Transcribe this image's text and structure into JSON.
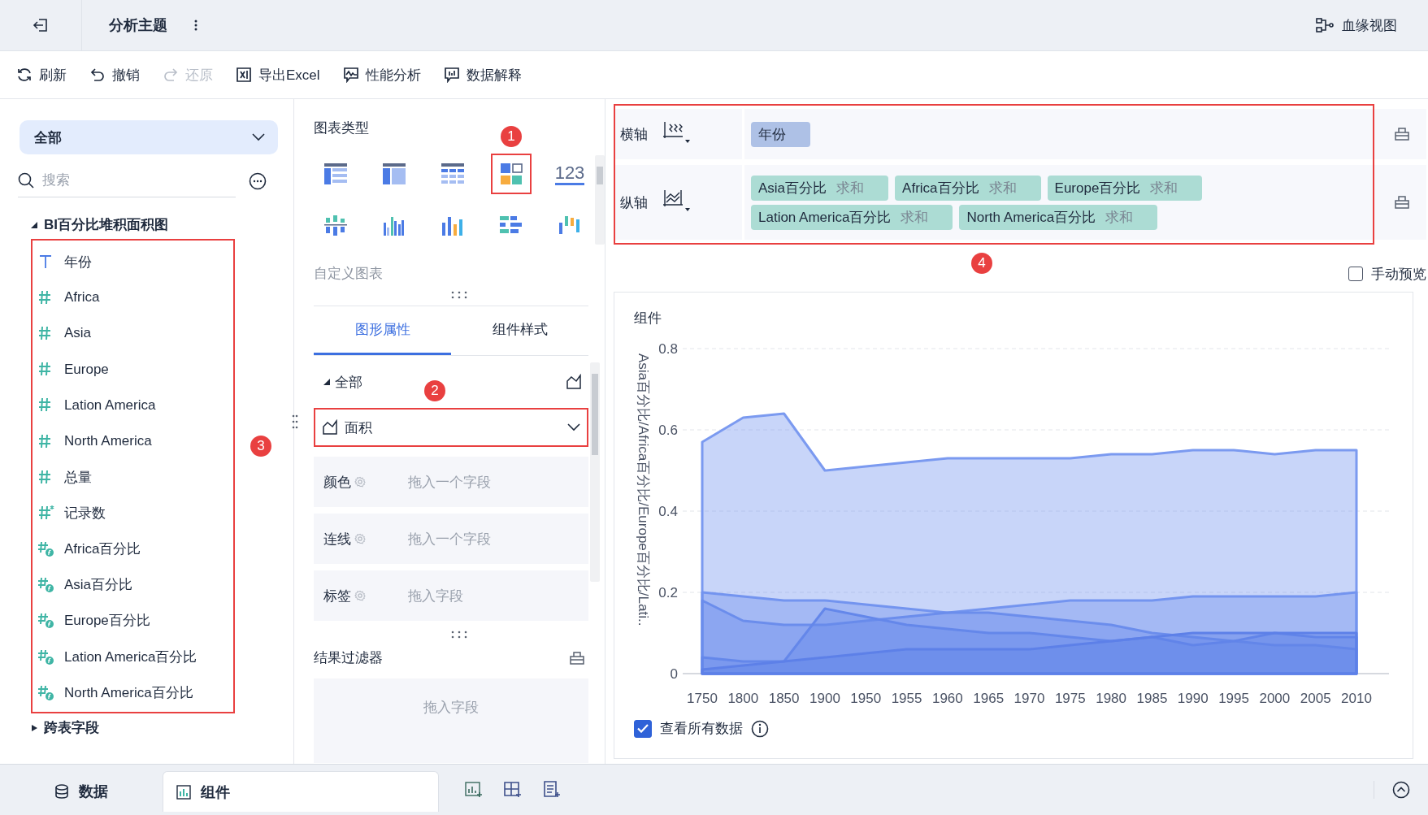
{
  "header": {
    "title": "分析主题",
    "lineage": "血缘视图"
  },
  "toolbar": [
    {
      "kind": "refresh",
      "label": "刷新",
      "disabled": false
    },
    {
      "kind": "undo",
      "label": "撤销",
      "disabled": false
    },
    {
      "kind": "redo",
      "label": "还原",
      "disabled": true
    },
    {
      "kind": "excel",
      "label": "导出Excel",
      "disabled": false
    },
    {
      "kind": "performance",
      "label": "性能分析",
      "disabled": false
    },
    {
      "kind": "explain",
      "label": "数据解释",
      "disabled": false
    }
  ],
  "data_panel": {
    "scope": "全部",
    "search": {
      "placeholder": "搜索"
    },
    "dataset": {
      "label": "BI百分比堆积面积图",
      "expanded": true,
      "callout": "3",
      "fields": [
        {
          "label": "年份",
          "kind": "text"
        },
        {
          "label": "Africa",
          "kind": "number"
        },
        {
          "label": "Asia",
          "kind": "number"
        },
        {
          "label": "Europe",
          "kind": "number"
        },
        {
          "label": "Lation America",
          "kind": "number"
        },
        {
          "label": "North America",
          "kind": "number"
        },
        {
          "label": "总量",
          "kind": "number"
        },
        {
          "label": "记录数",
          "kind": "count"
        },
        {
          "label": "Africa百分比",
          "kind": "calc"
        },
        {
          "label": "Asia百分比",
          "kind": "calc"
        },
        {
          "label": "Europe百分比",
          "kind": "calc"
        },
        {
          "label": "Lation America百分比",
          "kind": "calc"
        },
        {
          "label": "North America百分比",
          "kind": "calc"
        }
      ]
    },
    "other_group": {
      "label": "跨表字段",
      "expanded": false
    }
  },
  "chart_types": {
    "title": "图表类型",
    "items": [
      {
        "kind": "table",
        "selected": false
      },
      {
        "kind": "cross_table",
        "selected": false
      },
      {
        "kind": "detail_table",
        "selected": false
      },
      {
        "kind": "dashboard",
        "selected": true,
        "callout": "1"
      },
      {
        "kind": "kpi",
        "label": "123",
        "selected": false
      },
      {
        "kind": "dot_column",
        "selected": false
      },
      {
        "kind": "grouped_column",
        "selected": false
      },
      {
        "kind": "column",
        "selected": false
      },
      {
        "kind": "bar",
        "selected": false
      },
      {
        "kind": "range_column",
        "selected": false
      }
    ],
    "custom_label": "自定义图表"
  },
  "property_tabs": [
    {
      "label": "图形属性",
      "selected": true
    },
    {
      "label": "组件样式",
      "selected": false
    }
  ],
  "marks": {
    "scope": "全部",
    "expanded": true,
    "mark_type": "面积",
    "callout": "2",
    "slots": [
      {
        "label": "颜色",
        "placeholder": "拖入一个字段"
      },
      {
        "label": "连线",
        "placeholder": "拖入一个字段"
      },
      {
        "label": "标签",
        "placeholder": "拖入字段"
      }
    ]
  },
  "result_filter": {
    "title": "结果过滤器",
    "placeholder": "拖入字段"
  },
  "axes_callout": "4",
  "axes": [
    {
      "label": "横轴",
      "kind": "x",
      "fields": [
        {
          "name": "年份",
          "kind": "dimension"
        }
      ]
    },
    {
      "label": "纵轴",
      "kind": "y",
      "fields": [
        {
          "name": "Asia百分比",
          "aggregation": "求和",
          "kind": "measure"
        },
        {
          "name": "Africa百分比",
          "aggregation": "求和",
          "kind": "measure"
        },
        {
          "name": "Europe百分比",
          "aggregation": "求和",
          "kind": "measure"
        },
        {
          "name": "Lation America百分比",
          "aggregation": "求和",
          "kind": "measure"
        },
        {
          "name": "North America百分比",
          "aggregation": "求和",
          "kind": "measure"
        }
      ]
    }
  ],
  "manual_preview": {
    "label": "手动预览",
    "checked": false
  },
  "component": {
    "title": "组件",
    "chart_data": {
      "type": "area",
      "ylabel": "Asia百分比/Africa百分比/Europe百分比/Lati..",
      "categories": [
        "1750",
        "1800",
        "1850",
        "1900",
        "1950",
        "1955",
        "1960",
        "1965",
        "1970",
        "1975",
        "1980",
        "1985",
        "1990",
        "1995",
        "2000",
        "2005",
        "2010"
      ],
      "stacked": false,
      "grid": true,
      "ylim": [
        0,
        0.8
      ],
      "yticks": [
        0,
        0.2,
        0.4,
        0.6,
        0.8
      ],
      "series": [
        {
          "color": "#7b9af0",
          "values": [
            0.57,
            0.63,
            0.64,
            0.5,
            0.51,
            0.52,
            0.53,
            0.53,
            0.53,
            0.53,
            0.54,
            0.54,
            0.55,
            0.55,
            0.54,
            0.55,
            0.55
          ]
        },
        {
          "color": "#7394ef",
          "values": [
            0.2,
            0.19,
            0.18,
            0.18,
            0.17,
            0.16,
            0.15,
            0.16,
            0.17,
            0.18,
            0.18,
            0.18,
            0.19,
            0.19,
            0.19,
            0.19,
            0.2
          ]
        },
        {
          "color": "#6b8dec",
          "values": [
            0.18,
            0.13,
            0.12,
            0.12,
            0.13,
            0.14,
            0.15,
            0.15,
            0.14,
            0.13,
            0.12,
            0.1,
            0.09,
            0.08,
            0.07,
            0.07,
            0.06
          ]
        },
        {
          "color": "#6487ea",
          "values": [
            0.04,
            0.03,
            0.03,
            0.16,
            0.14,
            0.12,
            0.11,
            0.1,
            0.1,
            0.09,
            0.08,
            0.09,
            0.07,
            0.08,
            0.1,
            0.09,
            0.09
          ]
        },
        {
          "color": "#5d80e8",
          "values": [
            0.01,
            0.02,
            0.03,
            0.04,
            0.05,
            0.06,
            0.06,
            0.06,
            0.06,
            0.07,
            0.08,
            0.09,
            0.1,
            0.1,
            0.1,
            0.1,
            0.1
          ]
        }
      ]
    },
    "show_all_data": {
      "label": "查看所有数据",
      "checked": true
    }
  },
  "bottom_tabs": [
    {
      "label": "数据",
      "kind": "data",
      "selected": false
    },
    {
      "label": "组件",
      "kind": "component",
      "selected": true
    }
  ]
}
